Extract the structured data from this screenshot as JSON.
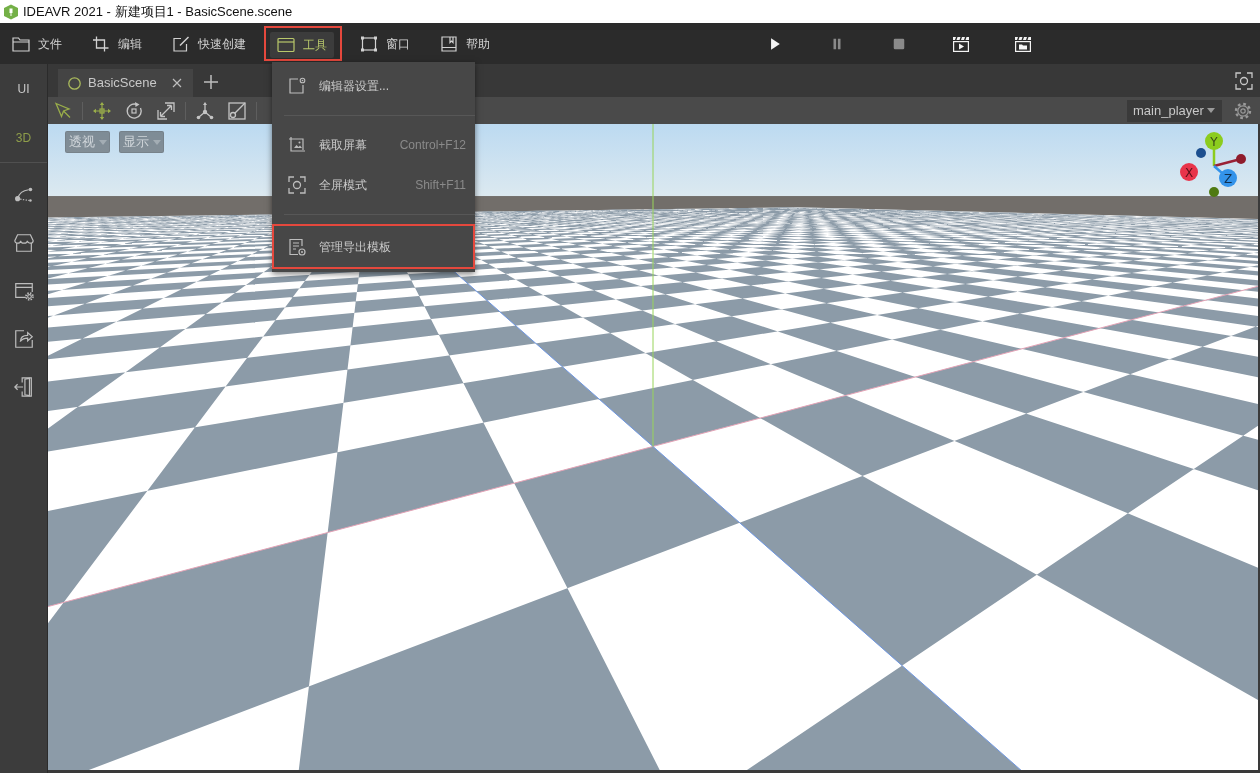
{
  "window": {
    "title": "IDEAVR 2021 - 新建项目1 - BasicScene.scene"
  },
  "menu_bar": {
    "items": [
      {
        "label": "文件",
        "selected": false,
        "highlighted": false
      },
      {
        "label": "编辑",
        "selected": false,
        "highlighted": false
      },
      {
        "label": "快速创建",
        "selected": false,
        "highlighted": false
      },
      {
        "label": "工具",
        "selected": true,
        "highlighted": true
      },
      {
        "label": "窗口",
        "selected": false,
        "highlighted": false
      },
      {
        "label": "帮助",
        "selected": false,
        "highlighted": false
      }
    ]
  },
  "playback_controls": [
    {
      "disabled": false
    },
    {
      "disabled": true
    },
    {
      "disabled": true
    },
    {
      "disabled": false
    },
    {
      "disabled": false
    }
  ],
  "side_panel": {
    "tabs": [
      {
        "label": "UI",
        "selected": false
      },
      {
        "label": "3D",
        "selected": true
      }
    ]
  },
  "document_tabs": [
    {
      "label": "BasicScene",
      "selected": true
    }
  ],
  "viewport_toolbar": {
    "tools": [
      {
        "selected": true
      },
      {
        "selected": true
      },
      {
        "selected": false
      },
      {
        "selected": false
      },
      {
        "selected": false
      },
      {
        "selected": false
      }
    ],
    "camera": "main_player"
  },
  "viewport": {
    "view_menus": [
      {
        "label": "透视"
      },
      {
        "label": "显示"
      }
    ],
    "gizmo": [
      {
        "label": "Y"
      },
      {
        "label": "X"
      },
      {
        "label": "Z"
      }
    ]
  },
  "tool_menu": {
    "items": [
      {
        "kind": "item",
        "label": "编辑器设置...",
        "highlighted": false
      },
      {
        "kind": "separator"
      },
      {
        "kind": "item",
        "label": "截取屏幕",
        "shortcut": "Control+F12",
        "highlighted": false
      },
      {
        "kind": "item",
        "label": "全屏模式",
        "shortcut": "Shift+F11",
        "highlighted": false
      },
      {
        "kind": "separator"
      },
      {
        "kind": "item",
        "label": "管理导出模板",
        "highlighted": true
      }
    ]
  }
}
